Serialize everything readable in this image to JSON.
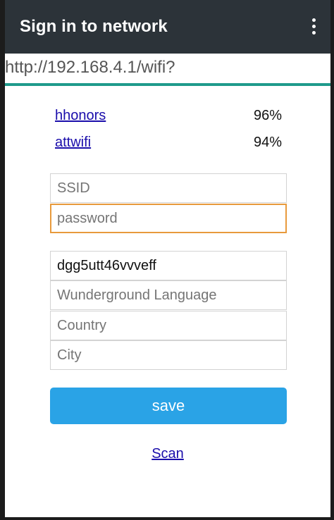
{
  "appbar": {
    "title": "Sign in to network",
    "menu_icon": "more-vertical-icon"
  },
  "urlbar": {
    "url": "http://192.168.4.1/wifi?"
  },
  "networks": [
    {
      "ssid": "hhonors",
      "signal": "96%"
    },
    {
      "ssid": "attwifi",
      "signal": "94%"
    }
  ],
  "form": {
    "ssid": {
      "value": "",
      "placeholder": "SSID"
    },
    "password": {
      "value": "",
      "placeholder": "password",
      "focused": true
    },
    "api_key": {
      "value": "dgg5utt46vvveff",
      "placeholder": ""
    },
    "language": {
      "value": "",
      "placeholder": "Wunderground Language"
    },
    "country": {
      "value": "",
      "placeholder": "Country"
    },
    "city": {
      "value": "",
      "placeholder": "City"
    }
  },
  "save_label": "save",
  "scan_label": "Scan",
  "colors": {
    "appbar": "#2c3339",
    "progress": "#1f9a8c",
    "focus_border": "#e89a3c",
    "save_button": "#2aa3e6",
    "link": "#1a0dab"
  }
}
